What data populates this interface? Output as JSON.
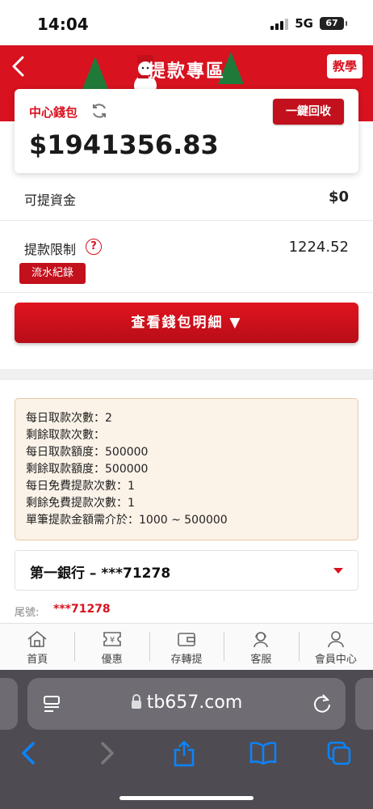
{
  "status_bar": {
    "time": "14:04",
    "network": "5G",
    "battery": "67"
  },
  "header": {
    "title": "提款專區",
    "teach_label": "教學",
    "bg_color": "#d8121f"
  },
  "wallet": {
    "label": "中心錢包",
    "recall_label": "一鍵回收",
    "amount": "$1941356.83"
  },
  "withdrawable": {
    "label": "可提資金",
    "value": "$0"
  },
  "limit": {
    "label": "提款限制",
    "help": "?",
    "value": "1224.52",
    "flow_label": "流水紀錄"
  },
  "detail_button": "查看錢包明細 ▼",
  "info_lines": [
    "每日取款次數：2",
    "剩餘取款次數：",
    "每日取款額度：500000",
    "剩餘取款額度：500000",
    "每日免費提款次數：1",
    "剩餘免費提款次數：1",
    "單筆提款金額需介於：1000 ~ 500000"
  ],
  "bank": {
    "selected": "第一銀行 – ***71278",
    "tail_label": "尾號:",
    "tail_value": "***71278"
  },
  "tabs": [
    {
      "label": "首頁",
      "icon": "home-icon"
    },
    {
      "label": "優惠",
      "icon": "coupon-icon"
    },
    {
      "label": "存轉提",
      "icon": "wallet-icon"
    },
    {
      "label": "客服",
      "icon": "support-icon"
    },
    {
      "label": "會員中心",
      "icon": "user-icon"
    }
  ],
  "browser": {
    "url": "tb657.com"
  },
  "colors": {
    "brand_red": "#d8121f",
    "safari_bg": "#4e4c52",
    "ios_blue": "#0a84ff"
  }
}
